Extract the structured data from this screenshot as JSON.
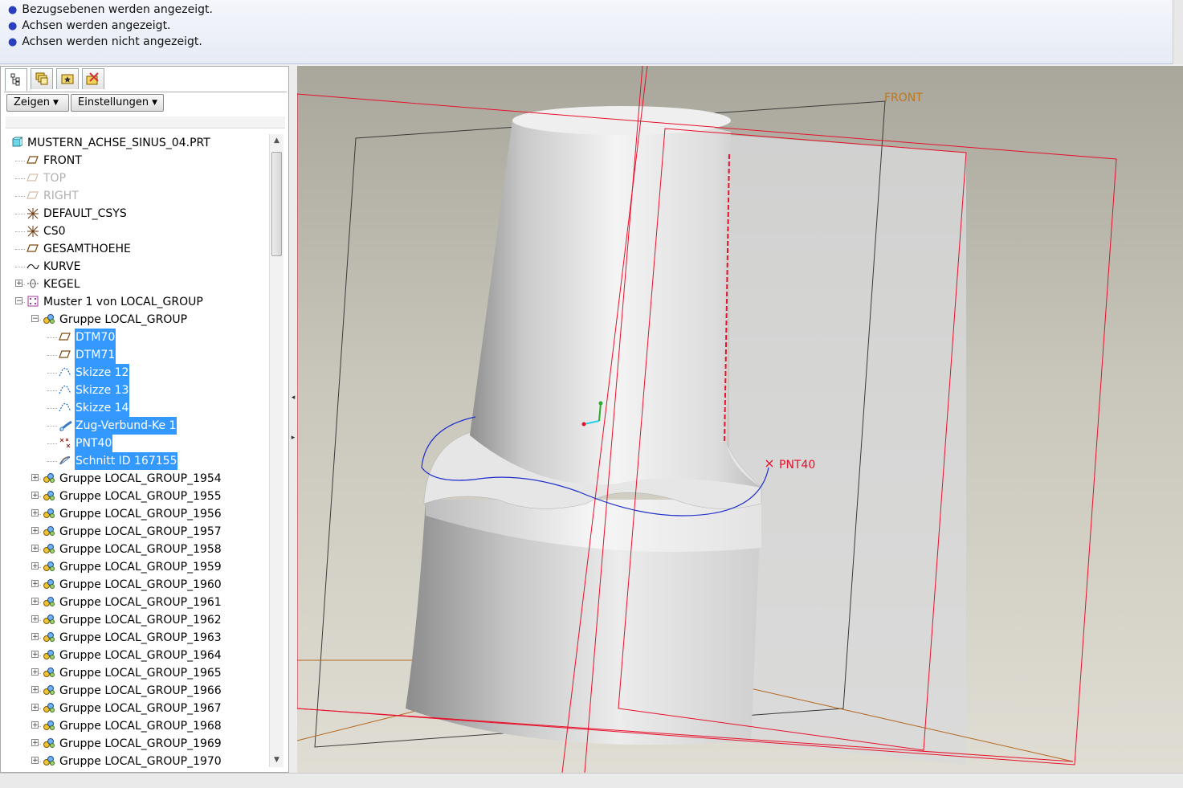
{
  "messages": [
    "Bezugsebenen werden angezeigt.",
    "Achsen werden angezeigt.",
    "Achsen werden nicht angezeigt."
  ],
  "panel": {
    "tabs": [
      {
        "icon": "model-tree-icon"
      },
      {
        "icon": "layers-icon"
      },
      {
        "icon": "favorites-icon"
      },
      {
        "icon": "tools-icon"
      }
    ],
    "buttons": {
      "show": "Zeigen",
      "settings": "Einstellungen"
    }
  },
  "tree": [
    {
      "label": "MUSTERN_ACHSE_SINUS_04.PRT",
      "icon": "part-icon",
      "level": 0,
      "expander": "",
      "selected": false,
      "dim": false
    },
    {
      "label": "FRONT",
      "icon": "datum-plane-icon",
      "level": 1,
      "expander": "",
      "selected": false,
      "dim": false
    },
    {
      "label": "TOP",
      "icon": "datum-plane-icon",
      "level": 1,
      "expander": "",
      "selected": false,
      "dim": true
    },
    {
      "label": "RIGHT",
      "icon": "datum-plane-icon",
      "level": 1,
      "expander": "",
      "selected": false,
      "dim": true
    },
    {
      "label": "DEFAULT_CSYS",
      "icon": "csys-icon",
      "level": 1,
      "expander": "",
      "selected": false,
      "dim": false
    },
    {
      "label": "CS0",
      "icon": "csys-icon",
      "level": 1,
      "expander": "",
      "selected": false,
      "dim": false
    },
    {
      "label": "GESAMTHOEHE",
      "icon": "datum-plane-icon",
      "level": 1,
      "expander": "",
      "selected": false,
      "dim": false
    },
    {
      "label": "KURVE",
      "icon": "curve-icon",
      "level": 1,
      "expander": "",
      "selected": false,
      "dim": false
    },
    {
      "label": "KEGEL",
      "icon": "revolve-icon",
      "level": 1,
      "expander": "+",
      "selected": false,
      "dim": false
    },
    {
      "label": "Muster 1 von LOCAL_GROUP",
      "icon": "pattern-icon",
      "level": 1,
      "expander": "-",
      "selected": false,
      "dim": false
    },
    {
      "label": "Gruppe LOCAL_GROUP",
      "icon": "group-icon",
      "level": 2,
      "expander": "-",
      "selected": false,
      "dim": false
    },
    {
      "label": "DTM70",
      "icon": "datum-plane-icon",
      "level": 3,
      "expander": "",
      "selected": true,
      "dim": false
    },
    {
      "label": "DTM71",
      "icon": "datum-plane-icon",
      "level": 3,
      "expander": "",
      "selected": true,
      "dim": false
    },
    {
      "label": "Skizze 12",
      "icon": "sketch-icon",
      "level": 3,
      "expander": "",
      "selected": true,
      "dim": false
    },
    {
      "label": "Skizze 13",
      "icon": "sketch-icon",
      "level": 3,
      "expander": "",
      "selected": true,
      "dim": false
    },
    {
      "label": "Skizze 14",
      "icon": "sketch-icon",
      "level": 3,
      "expander": "",
      "selected": true,
      "dim": false
    },
    {
      "label": "Zug-Verbund-Ke 1",
      "icon": "sweep-icon",
      "level": 3,
      "expander": "",
      "selected": true,
      "dim": false
    },
    {
      "label": "PNT40",
      "icon": "datum-point-icon",
      "level": 3,
      "expander": "",
      "selected": true,
      "dim": false
    },
    {
      "label": "Schnitt ID 167155",
      "icon": "cut-icon",
      "level": 3,
      "expander": "",
      "selected": true,
      "dim": false
    },
    {
      "label": "Gruppe LOCAL_GROUP_1954",
      "icon": "group-icon",
      "level": 2,
      "expander": "+",
      "selected": false,
      "dim": false
    },
    {
      "label": "Gruppe LOCAL_GROUP_1955",
      "icon": "group-icon",
      "level": 2,
      "expander": "+",
      "selected": false,
      "dim": false
    },
    {
      "label": "Gruppe LOCAL_GROUP_1956",
      "icon": "group-icon",
      "level": 2,
      "expander": "+",
      "selected": false,
      "dim": false
    },
    {
      "label": "Gruppe LOCAL_GROUP_1957",
      "icon": "group-icon",
      "level": 2,
      "expander": "+",
      "selected": false,
      "dim": false
    },
    {
      "label": "Gruppe LOCAL_GROUP_1958",
      "icon": "group-icon",
      "level": 2,
      "expander": "+",
      "selected": false,
      "dim": false
    },
    {
      "label": "Gruppe LOCAL_GROUP_1959",
      "icon": "group-icon",
      "level": 2,
      "expander": "+",
      "selected": false,
      "dim": false
    },
    {
      "label": "Gruppe LOCAL_GROUP_1960",
      "icon": "group-icon",
      "level": 2,
      "expander": "+",
      "selected": false,
      "dim": false
    },
    {
      "label": "Gruppe LOCAL_GROUP_1961",
      "icon": "group-icon",
      "level": 2,
      "expander": "+",
      "selected": false,
      "dim": false
    },
    {
      "label": "Gruppe LOCAL_GROUP_1962",
      "icon": "group-icon",
      "level": 2,
      "expander": "+",
      "selected": false,
      "dim": false
    },
    {
      "label": "Gruppe LOCAL_GROUP_1963",
      "icon": "group-icon",
      "level": 2,
      "expander": "+",
      "selected": false,
      "dim": false
    },
    {
      "label": "Gruppe LOCAL_GROUP_1964",
      "icon": "group-icon",
      "level": 2,
      "expander": "+",
      "selected": false,
      "dim": false
    },
    {
      "label": "Gruppe LOCAL_GROUP_1965",
      "icon": "group-icon",
      "level": 2,
      "expander": "+",
      "selected": false,
      "dim": false
    },
    {
      "label": "Gruppe LOCAL_GROUP_1966",
      "icon": "group-icon",
      "level": 2,
      "expander": "+",
      "selected": false,
      "dim": false
    },
    {
      "label": "Gruppe LOCAL_GROUP_1967",
      "icon": "group-icon",
      "level": 2,
      "expander": "+",
      "selected": false,
      "dim": false
    },
    {
      "label": "Gruppe LOCAL_GROUP_1968",
      "icon": "group-icon",
      "level": 2,
      "expander": "+",
      "selected": false,
      "dim": false
    },
    {
      "label": "Gruppe LOCAL_GROUP_1969",
      "icon": "group-icon",
      "level": 2,
      "expander": "+",
      "selected": false,
      "dim": false
    },
    {
      "label": "Gruppe LOCAL_GROUP_1970",
      "icon": "group-icon",
      "level": 2,
      "expander": "+",
      "selected": false,
      "dim": false
    }
  ],
  "viewport": {
    "plane_label": "FRONT",
    "point_label": "PNT40",
    "colors": {
      "selection": "#e8102a",
      "curve": "#1f2ecc",
      "plane_outline": "#3a3a3a",
      "plane_edge_orange": "#b5651d",
      "plane_label": "#c0761b",
      "tree_highlight": "#3399ff"
    }
  }
}
